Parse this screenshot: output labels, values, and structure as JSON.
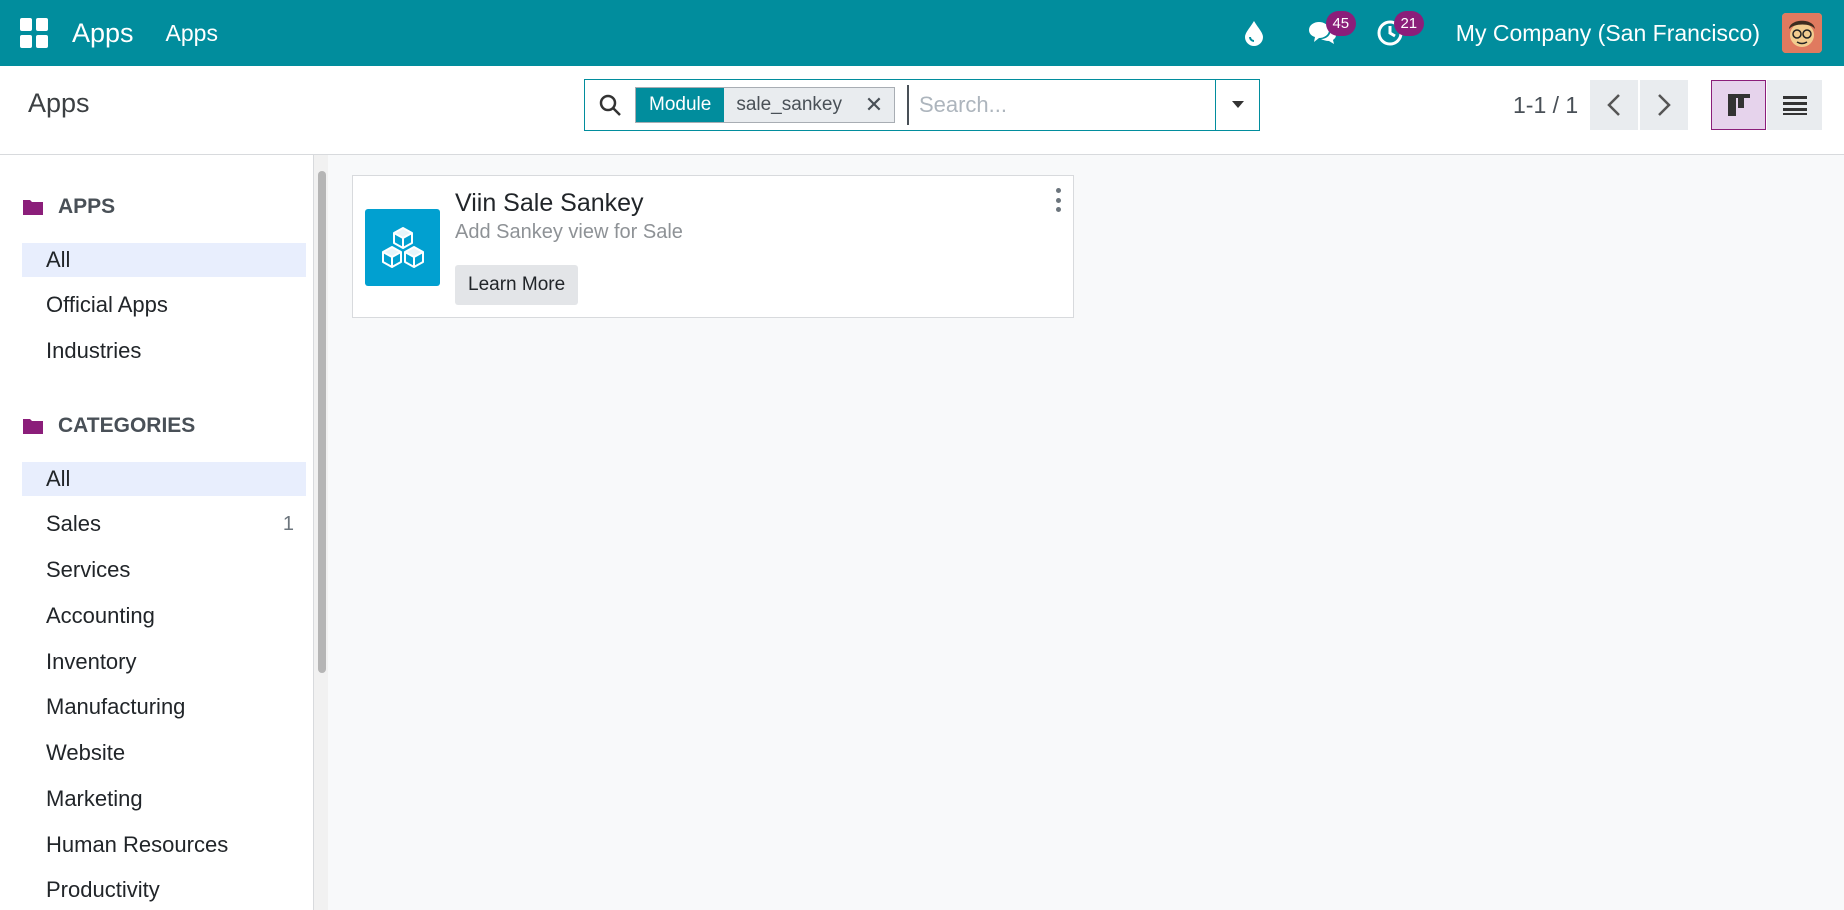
{
  "navbar": {
    "brand": "Apps",
    "menu_item": "Apps",
    "messages_count": "45",
    "activities_count": "21",
    "company": "My Company (San Francisco)",
    "bg_color": "#018d9d",
    "badge_color": "#8b1e7a",
    "icons": [
      "apps-grid-icon",
      "droplet-icon",
      "chat-icon",
      "clock-icon",
      "avatar"
    ]
  },
  "control_panel": {
    "title": "Apps",
    "search": {
      "facet_name": "Module",
      "facet_value": "sale_sankey",
      "placeholder": "Search..."
    },
    "pager": "1-1 / 1"
  },
  "sidebar": {
    "apps_section": {
      "heading": "APPS",
      "items": [
        {
          "label": "All",
          "active": true
        },
        {
          "label": "Official Apps"
        },
        {
          "label": "Industries"
        }
      ]
    },
    "categories_section": {
      "heading": "CATEGORIES",
      "items": [
        {
          "label": "All",
          "active": true
        },
        {
          "label": "Sales",
          "count": "1"
        },
        {
          "label": "Services"
        },
        {
          "label": "Accounting"
        },
        {
          "label": "Inventory"
        },
        {
          "label": "Manufacturing"
        },
        {
          "label": "Website"
        },
        {
          "label": "Marketing"
        },
        {
          "label": "Human Resources"
        },
        {
          "label": "Productivity"
        }
      ]
    },
    "folder_color": "#8b1e7a",
    "active_bg": "#e8eefd"
  },
  "results": [
    {
      "title": "Viin Sale Sankey",
      "summary": "Add Sankey view for Sale",
      "button": "Learn More",
      "icon": "cubes-icon",
      "icon_bg": "#01a0d0"
    }
  ]
}
